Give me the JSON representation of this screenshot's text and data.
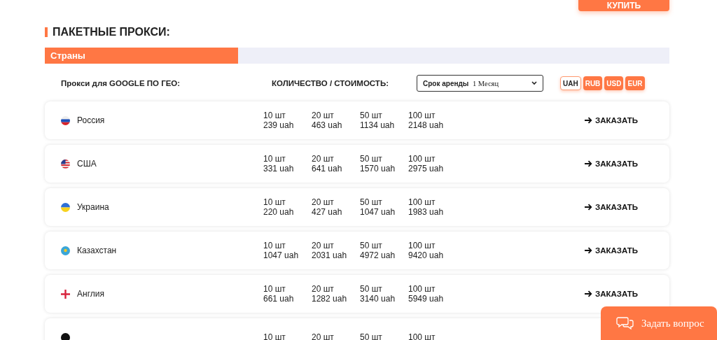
{
  "buy_button": "КУПИТЬ",
  "section_title": "ПАКЕТНЫЕ ПРОКСИ:",
  "tabs": [
    {
      "label": "Страны",
      "selected": true
    }
  ],
  "filters": {
    "geo_label": "Прокси для GOOGLE ПО ГЕО:",
    "price_label": "КОЛИЧЕСТВО / СТОИМОСТЬ:",
    "rent_select": {
      "label": "Срок аренды",
      "value": "1 Месяц"
    },
    "currencies": [
      {
        "label": "UAH",
        "selected": true
      },
      {
        "label": "RUB",
        "selected": false
      },
      {
        "label": "USD",
        "selected": false
      },
      {
        "label": "EUR",
        "selected": false
      }
    ]
  },
  "rows": [
    {
      "country": "Россия",
      "packages": [
        {
          "qty": "10 шт",
          "price": "239 uah"
        },
        {
          "qty": "20 шт",
          "price": "463 uah"
        },
        {
          "qty": "50 шт",
          "price": "1134 uah"
        },
        {
          "qty": "100 шт",
          "price": "2148 uah"
        }
      ],
      "order": "ЗАКАЗАТЬ"
    },
    {
      "country": "США",
      "packages": [
        {
          "qty": "10 шт",
          "price": "331 uah"
        },
        {
          "qty": "20 шт",
          "price": "641 uah"
        },
        {
          "qty": "50 шт",
          "price": "1570 uah"
        },
        {
          "qty": "100 шт",
          "price": "2975 uah"
        }
      ],
      "order": "ЗАКАЗАТЬ"
    },
    {
      "country": "Украина",
      "packages": [
        {
          "qty": "10 шт",
          "price": "220 uah"
        },
        {
          "qty": "20 шт",
          "price": "427 uah"
        },
        {
          "qty": "50 шт",
          "price": "1047 uah"
        },
        {
          "qty": "100 шт",
          "price": "1983 uah"
        }
      ],
      "order": "ЗАКАЗАТЬ"
    },
    {
      "country": "Казахстан",
      "packages": [
        {
          "qty": "10 шт",
          "price": "1047 uah"
        },
        {
          "qty": "20 шт",
          "price": "2031 uah"
        },
        {
          "qty": "50 шт",
          "price": "4972 uah"
        },
        {
          "qty": "100 шт",
          "price": "9420 uah"
        }
      ],
      "order": "ЗАКАЗАТЬ"
    },
    {
      "country": "Англия",
      "packages": [
        {
          "qty": "10 шт",
          "price": "661 uah"
        },
        {
          "qty": "20 шт",
          "price": "1282 uah"
        },
        {
          "qty": "50 шт",
          "price": "3140 uah"
        },
        {
          "qty": "100 шт",
          "price": "5949 uah"
        }
      ],
      "order": "ЗАКАЗАТЬ"
    },
    {
      "packages": [
        {
          "qty": "10 шт"
        },
        {
          "qty": "20 шт"
        },
        {
          "qty": "50 шт"
        },
        {
          "qty": "100 шт"
        }
      ]
    }
  ],
  "chat_button": "Задать вопрос"
}
